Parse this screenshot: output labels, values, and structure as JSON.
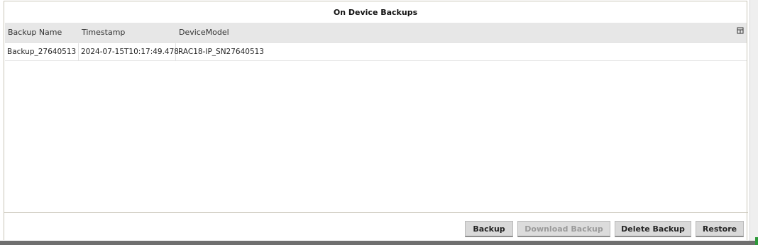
{
  "panel": {
    "title": "On Device Backups"
  },
  "grid": {
    "columns": [
      "Backup Name",
      "Timestamp",
      "DeviceModel"
    ],
    "rows": [
      [
        "Backup_27640513",
        "2024-07-15T10:17:49.478",
        "RAC18-IP_SN27640513"
      ]
    ],
    "column_menu_icon": "column-menu-icon"
  },
  "buttons": {
    "backup": "Backup",
    "download_backup": "Download Backup",
    "delete_backup": "Delete Backup",
    "restore": "Restore"
  },
  "colors": {
    "header_bg": "#e7e7e7",
    "button_bg": "#d9d9d9",
    "accent_green": "#2e9a3a"
  }
}
